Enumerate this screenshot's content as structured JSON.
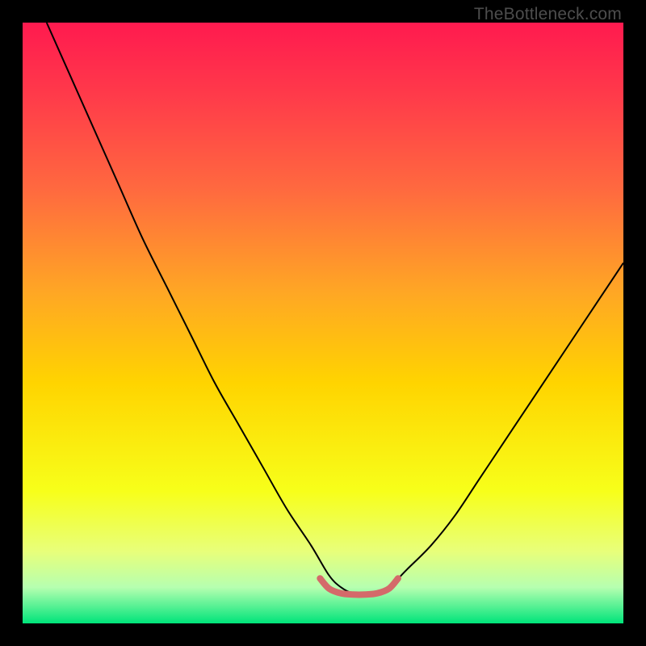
{
  "attribution": "TheBottleneck.com",
  "chart_data": {
    "type": "line",
    "title": "",
    "xlabel": "",
    "ylabel": "",
    "xlim": [
      0,
      100
    ],
    "ylim": [
      0,
      100
    ],
    "grid": false,
    "legend": false,
    "background": {
      "type": "vertical-gradient",
      "stops": [
        {
          "pos": 0.0,
          "color": "#ff1a4f"
        },
        {
          "pos": 0.12,
          "color": "#ff3a4a"
        },
        {
          "pos": 0.28,
          "color": "#ff6a3f"
        },
        {
          "pos": 0.45,
          "color": "#ffa724"
        },
        {
          "pos": 0.6,
          "color": "#ffd400"
        },
        {
          "pos": 0.78,
          "color": "#f7ff1a"
        },
        {
          "pos": 0.88,
          "color": "#e8ff7a"
        },
        {
          "pos": 0.94,
          "color": "#b6ffb0"
        },
        {
          "pos": 1.0,
          "color": "#00e47a"
        }
      ]
    },
    "series": [
      {
        "name": "bottleneck-curve",
        "color": "#000000",
        "width": 2,
        "x": [
          4,
          8,
          12,
          16,
          20,
          24,
          28,
          32,
          36,
          40,
          44,
          48,
          51,
          53,
          55,
          57,
          59,
          61,
          64,
          68,
          72,
          76,
          80,
          84,
          88,
          92,
          96,
          100
        ],
        "y": [
          100,
          91,
          82,
          73,
          64,
          56,
          48,
          40,
          33,
          26,
          19,
          13,
          8,
          6,
          5,
          5,
          5,
          6,
          9,
          13,
          18,
          24,
          30,
          36,
          42,
          48,
          54,
          60
        ]
      },
      {
        "name": "optimal-band",
        "color": "#d46a6a",
        "width": 8,
        "linecap": "round",
        "x": [
          49.5,
          51,
          53,
          55,
          57,
          59,
          61,
          62.5
        ],
        "y": [
          7.5,
          5.8,
          5.0,
          4.8,
          4.8,
          5.0,
          5.8,
          7.5
        ]
      }
    ]
  }
}
